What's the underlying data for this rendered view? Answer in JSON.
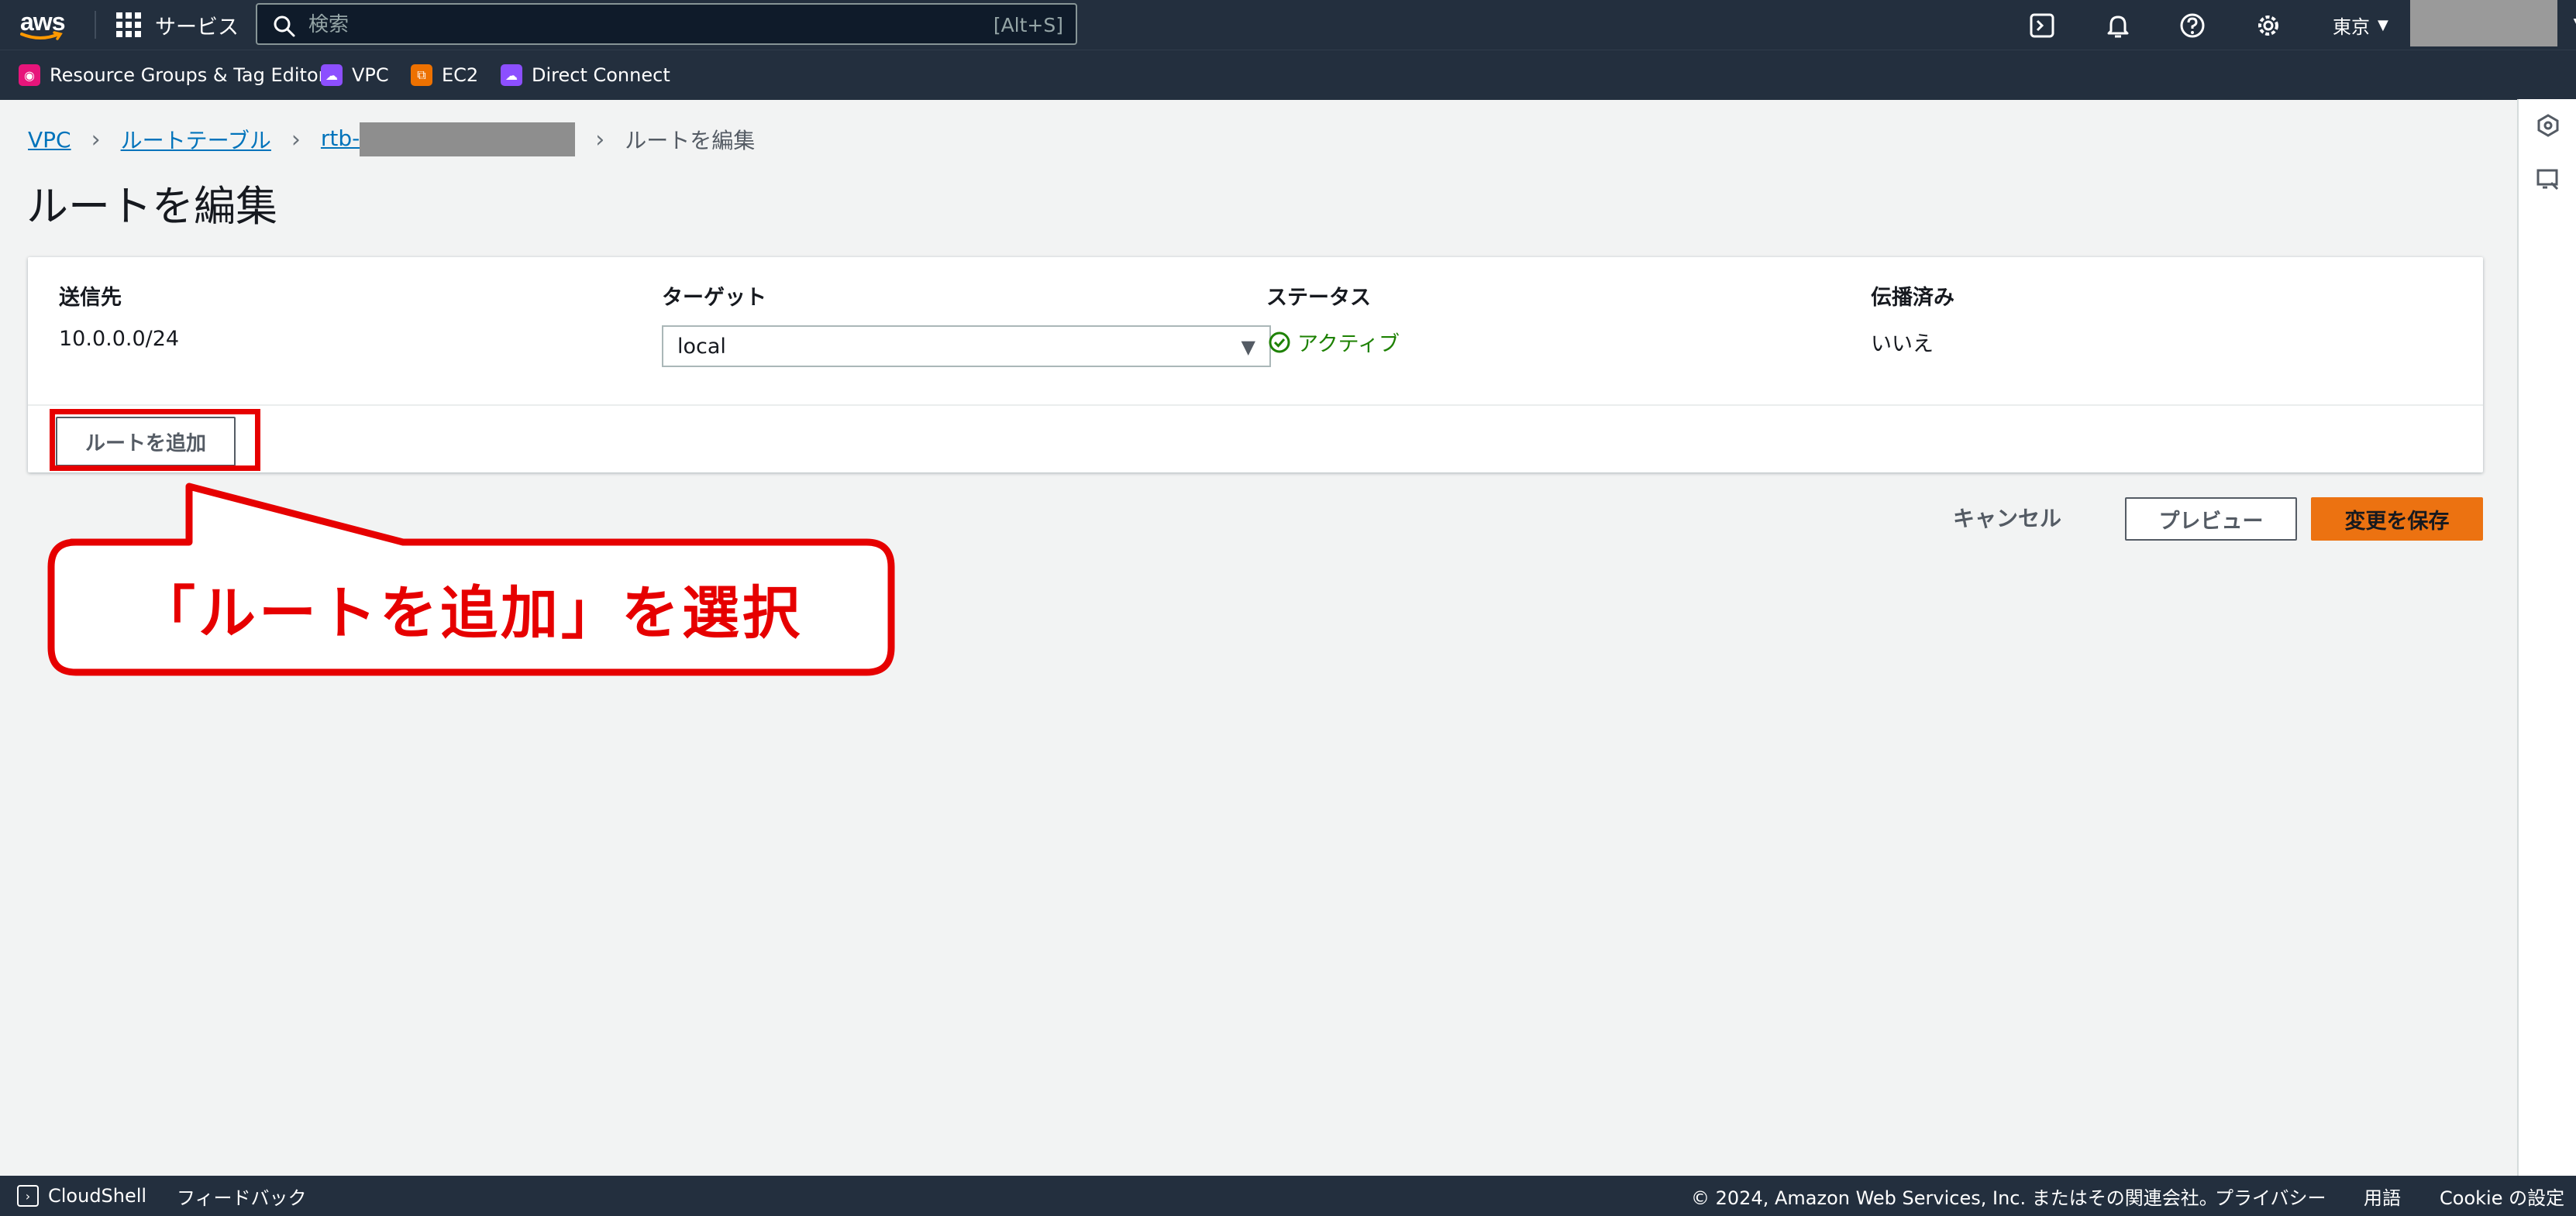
{
  "topnav": {
    "logo": "aws",
    "services_label": "サービス",
    "search_placeholder": "検索",
    "search_shortcut": "[Alt+S]",
    "region_label": "東京",
    "icons": [
      "cloudshell-icon",
      "notifications-icon",
      "help-icon",
      "settings-icon"
    ]
  },
  "favorites": [
    {
      "label": "Resource Groups & Tag Editor",
      "color": "#e7157b"
    },
    {
      "label": "VPC",
      "color": "#8c4fff"
    },
    {
      "label": "EC2",
      "color": "#ed7100"
    },
    {
      "label": "Direct Connect",
      "color": "#8c4fff"
    }
  ],
  "breadcrumb": {
    "vpc": "VPC",
    "route_tables": "ルートテーブル",
    "rtb_prefix": "rtb-",
    "current": "ルートを編集"
  },
  "page_title": "ルートを編集",
  "routes_table": {
    "headers": {
      "destination": "送信先",
      "target": "ターゲット",
      "status": "ステータス",
      "propagated": "伝播済み"
    },
    "rows": [
      {
        "destination": "10.0.0.0/24",
        "target": "local",
        "status": "アクティブ",
        "propagated": "いいえ"
      }
    ]
  },
  "buttons": {
    "add_route": "ルートを追加",
    "cancel": "キャンセル",
    "preview": "プレビュー",
    "save": "変更を保存"
  },
  "annotation": {
    "callout_text": "「ルートを追加」を選択",
    "color": "#e60000"
  },
  "footer": {
    "cloudshell": "CloudShell",
    "feedback": "フィードバック",
    "copyright": "© 2024, Amazon Web Services, Inc. またはその関連会社。",
    "privacy": "プライバシー",
    "terms": "用語",
    "cookie": "Cookie の設定"
  },
  "colors": {
    "nav_bg": "#232f3e",
    "page_bg": "#f2f3f3",
    "link": "#0073bb",
    "status_ok": "#1d8102",
    "primary_button": "#ec7211"
  }
}
